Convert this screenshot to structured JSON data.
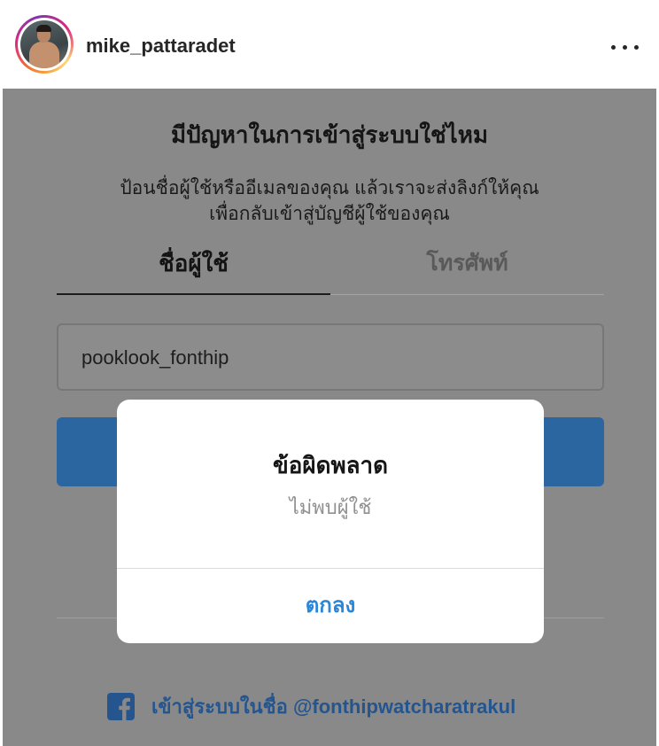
{
  "post_header": {
    "avatar": "profile-photo",
    "username": "mike_pattaradet",
    "more_icon": "more-horizontal-icon"
  },
  "screen": {
    "title": "มีปัญหาในการเข้าสู่ระบบใช่ไหม",
    "subtitle_line1": "ป้อนชื่อผู้ใช้หรืออีเมลของคุณ แล้วเราจะส่งลิงก์ให้คุณ",
    "subtitle_line2": "เพื่อกลับเข้าสู่บัญชีผู้ใช้ของคุณ",
    "tabs": [
      {
        "label": "ชื่อผู้ใช้",
        "active": true
      },
      {
        "label": "โทรศัพท์",
        "active": false
      }
    ],
    "username_input": {
      "value": "pooklook_fonthip"
    },
    "facebook_login": {
      "icon": "facebook-icon",
      "label": "เข้าสู่ระบบในชื่อ @fonthipwatcharatrakul"
    }
  },
  "dialog": {
    "title": "ข้อผิดพลาด",
    "message": "ไม่พบผู้ใช้",
    "ok_label": "ตกลง"
  },
  "colors": {
    "overlay": "#898989",
    "primary_button": "#2b66a1",
    "dialog_link": "#2a86d6",
    "facebook_link": "#24558f"
  }
}
